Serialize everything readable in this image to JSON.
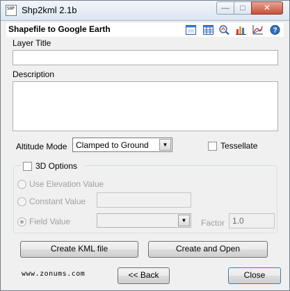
{
  "window": {
    "title": "Shp2kml 2.1b",
    "icon_text": "SHP"
  },
  "header": {
    "title": "Shapefile to Google Earth",
    "toolbar_icons": [
      "window-icon",
      "table-icon",
      "zoom-settings-icon",
      "bar-chart-icon",
      "line-chart-icon",
      "help-icon"
    ]
  },
  "form": {
    "layer_title_label": "Layer Title",
    "layer_title_value": "",
    "description_label": "Description",
    "description_value": "",
    "altitude_mode_label": "Altitude Mode",
    "altitude_mode_value": "Clamped to Ground",
    "tessellate_label": "Tessellate"
  },
  "options3d": {
    "label": "3D Options",
    "use_elevation_label": "Use Elevation Value",
    "constant_value_label": "Constant Value",
    "constant_value": "",
    "field_value_label": "Field Value",
    "field_value": "",
    "factor_label": "Factor",
    "factor_value": "1.0"
  },
  "actions": {
    "create_kml_label": "Create KML file",
    "create_open_label": "Create and Open",
    "back_label": "<< Back",
    "close_label": "Close"
  },
  "footer": {
    "url": "www.zonums.com"
  }
}
